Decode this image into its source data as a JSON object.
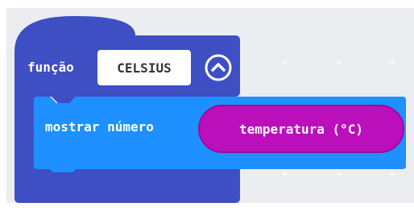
{
  "function_block": {
    "keyword": "função",
    "name": "CELSIUS",
    "collapse_icon": "chevron-up-circle-icon",
    "color": "#3e4fc4"
  },
  "statement_block": {
    "label": "mostrar número",
    "color": "#1e90ff"
  },
  "reporter_block": {
    "label": "temperatura (°C)",
    "color": "#bc0fbc"
  }
}
